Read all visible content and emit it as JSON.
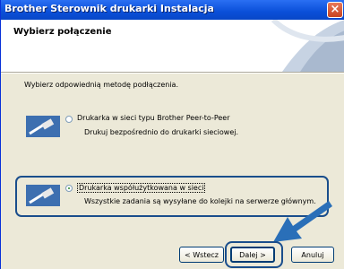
{
  "window": {
    "title": "Brother Sterownik drukarki Instalacja",
    "close_label": "×"
  },
  "header": {
    "title": "Wybierz połączenie"
  },
  "prompt": "Wybierz odpowiednią metodę podłączenia.",
  "options": [
    {
      "label": "Drukarka w sieci typu Brother Peer-to-Peer",
      "description": "Drukuj bezpośrednio do drukarki sieciowej.",
      "selected": false
    },
    {
      "label": "Drukarka współużytkowana w sieci",
      "description": "Wszystkie zadania są wysyłane do kolejki na serwerze głównym.",
      "selected": true
    }
  ],
  "buttons": {
    "back": "< Wstecz",
    "next": "Dalej >",
    "cancel": "Anuluj"
  },
  "colors": {
    "titlebar": "#0a4fd8",
    "highlight": "#1a4e8c",
    "arrow": "#2a6fb8"
  }
}
